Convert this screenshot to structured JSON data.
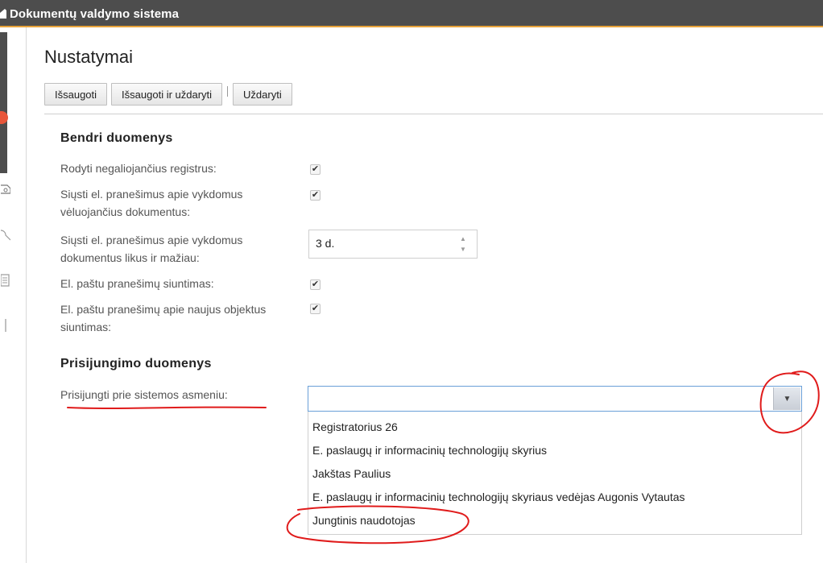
{
  "app": {
    "title": "Dokumentų valdymo sistema"
  },
  "page": {
    "title": "Nustatymai"
  },
  "toolbar": {
    "save_label": "Išsaugoti",
    "save_close_label": "Išsaugoti ir uždaryti",
    "separator": "|",
    "close_label": "Uždaryti"
  },
  "general": {
    "title": "Bendri duomenys",
    "show_invalid_registers": {
      "label": "Rodyti negaliojančius registrus:",
      "checked": true
    },
    "email_overdue": {
      "label": "Siųsti el. pranešimus apie vykdomus vėluojančius dokumentus:",
      "checked": true
    },
    "email_remaining": {
      "label": "Siųsti el. pranešimus apie vykdomus dokumentus likus ir mažiau:",
      "value": "3 d."
    },
    "email_sending": {
      "label": "El. paštu pranešimų siuntimas:",
      "checked": true
    },
    "email_new_objects": {
      "label": "El. paštu pranešimų apie naujus objektus siuntimas:",
      "checked": true
    }
  },
  "login": {
    "title": "Prisijungimo duomenys",
    "connect_as_label": "Prisijungti prie sistemos asmeniu:",
    "connect_as_value": "",
    "options": [
      "Registratorius 26",
      "E. paslaugų ir informacinių technologijų skyrius",
      "Jakštas Paulius",
      "E. paslaugų ir informacinių technologijų skyriaus vedėjas Augonis Vytautas",
      "Jungtinis naudotojas"
    ]
  },
  "colors": {
    "titlebar": "#4d4d4d",
    "titlebar_accent": "#e8a33a",
    "annotation_red": "#e01b1b",
    "combo_focus": "#6aa0d8"
  }
}
